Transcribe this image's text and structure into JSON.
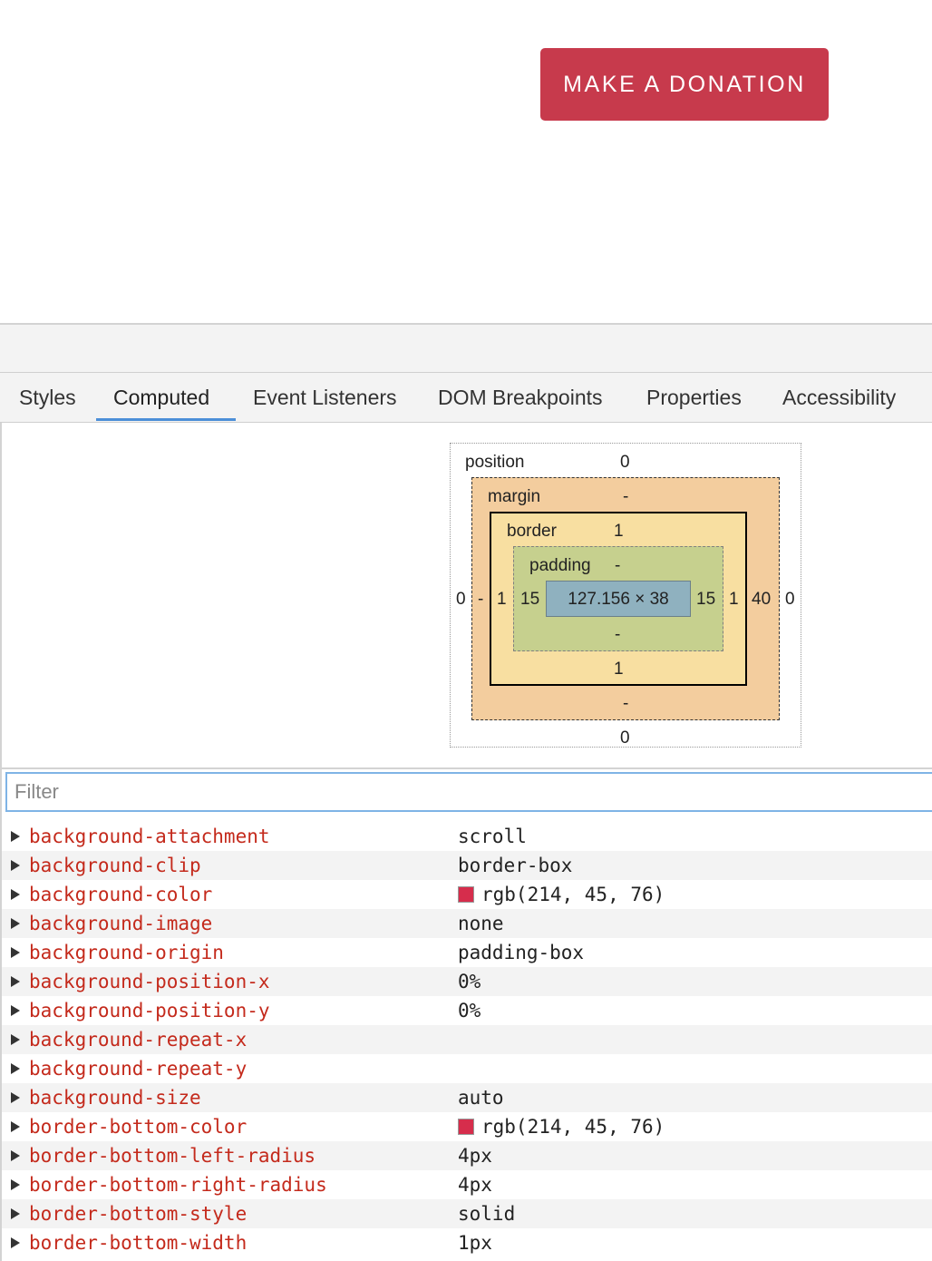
{
  "page": {
    "donate_button_label": "MAKE A DONATION",
    "donate_button_color": "#c73a4c"
  },
  "devtools": {
    "tabs": [
      {
        "label": "Styles",
        "active": false
      },
      {
        "label": "Computed",
        "active": true
      },
      {
        "label": "Event Listeners",
        "active": false
      },
      {
        "label": "DOM Breakpoints",
        "active": false
      },
      {
        "label": "Properties",
        "active": false
      },
      {
        "label": "Accessibility",
        "active": false
      }
    ],
    "accent_color": "#4c8fd8",
    "box_model": {
      "position": {
        "label": "position",
        "top": "0",
        "right": "0",
        "bottom": "0",
        "left": "0"
      },
      "margin": {
        "label": "margin",
        "top": "-",
        "right": "40",
        "bottom": "-",
        "left": "-"
      },
      "border": {
        "label": "border",
        "top": "1",
        "right": "1",
        "bottom": "1",
        "left": "1"
      },
      "padding": {
        "label": "padding",
        "top": "-",
        "right": "15",
        "bottom": "-",
        "left": "15"
      },
      "content": "127.156 × 38",
      "colors": {
        "margin": "#f3cd9e",
        "border": "#f8dfa1",
        "padding": "#c6d08e",
        "content": "#8fb1bf"
      }
    },
    "filter": {
      "placeholder": "Filter",
      "value": ""
    },
    "computed_properties": [
      {
        "name": "background-attachment",
        "value": "scroll"
      },
      {
        "name": "background-clip",
        "value": "border-box"
      },
      {
        "name": "background-color",
        "value": "rgb(214, 45, 76)",
        "swatch": "#d62d4c"
      },
      {
        "name": "background-image",
        "value": "none"
      },
      {
        "name": "background-origin",
        "value": "padding-box"
      },
      {
        "name": "background-position-x",
        "value": "0%"
      },
      {
        "name": "background-position-y",
        "value": "0%"
      },
      {
        "name": "background-repeat-x",
        "value": ""
      },
      {
        "name": "background-repeat-y",
        "value": ""
      },
      {
        "name": "background-size",
        "value": "auto"
      },
      {
        "name": "border-bottom-color",
        "value": "rgb(214, 45, 76)",
        "swatch": "#d62d4c"
      },
      {
        "name": "border-bottom-left-radius",
        "value": "4px"
      },
      {
        "name": "border-bottom-right-radius",
        "value": "4px"
      },
      {
        "name": "border-bottom-style",
        "value": "solid"
      },
      {
        "name": "border-bottom-width",
        "value": "1px"
      }
    ]
  }
}
